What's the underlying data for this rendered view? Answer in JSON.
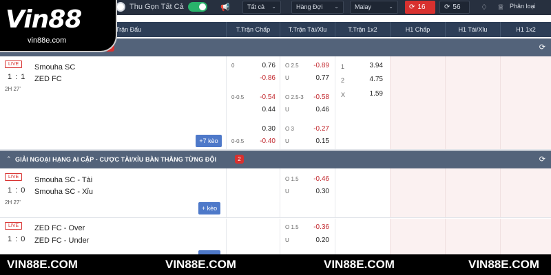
{
  "toolbar": {
    "collapse_all_label": "Thu Gọn Tất Cả",
    "speaker_icon": "speaker-icon",
    "filter_all": "Tất cả",
    "sort_by": "Hàng Đợi",
    "odds_type": "Malay",
    "live_count": "16",
    "upcoming_count": "56",
    "classify_label": "Phân loại"
  },
  "columns": {
    "match": "Trận Đấu",
    "ft_handicap": "T.Trận Chấp",
    "ft_over_under": "T.Trận Tài/Xỉu",
    "ft_1x2": "T.Trận 1x2",
    "h1_handicap": "H1 Chấp",
    "h1_over_under": "H1 Tài/Xỉu",
    "h1_1x2": "H1 1x2"
  },
  "league1": {
    "count": "1"
  },
  "match1": {
    "status": "LIVE",
    "score": "1 : 1",
    "time": "2H 27'",
    "home": "Smouha SC",
    "away": "ZED FC",
    "more": "+7 kèo",
    "rows": [
      {
        "hdp": "0",
        "hdp_home": "0.76",
        "hdp_away": "-0.86",
        "ou_line": "O 2.5",
        "ou_over": "-0.89",
        "ou_u": "U",
        "ou_under": "0.77"
      },
      {
        "hdp": "0-0.5",
        "hdp_home": "-0.54",
        "hdp_away": "0.44",
        "ou_line": "O 2.5-3",
        "ou_over": "-0.58",
        "ou_u": "U",
        "ou_under": "0.46"
      },
      {
        "hdp": "0-0.5",
        "hdp_home": "0.30",
        "hdp_away": "-0.40",
        "ou_line": "O 3",
        "ou_over": "-0.27",
        "ou_u": "U",
        "ou_under": "0.15"
      }
    ],
    "x12": [
      {
        "label": "1",
        "value": "3.94"
      },
      {
        "label": "2",
        "value": "4.75"
      },
      {
        "label": "X",
        "value": "1.59"
      }
    ]
  },
  "league2": {
    "name": "GIẢI NGOẠI HẠNG AI CẬP - CƯỢC TÀI/XỈU BÀN THẮNG TỪNG ĐỘI",
    "count": "2"
  },
  "match2": {
    "status": "LIVE",
    "score": "1 : 0",
    "time": "2H 27'",
    "home": "Smouha SC - Tài",
    "away": "Smouha SC - Xỉu",
    "more": "+ kèo",
    "ou_line": "O 1.5",
    "ou_over": "-0.46",
    "ou_u": "U",
    "ou_under": "0.30"
  },
  "match3": {
    "status": "LIVE",
    "score": "1 : 0",
    "home": "ZED FC - Over",
    "away": "ZED FC - Under",
    "ou_line": "O 1.5",
    "ou_over": "-0.36",
    "ou_u": "U",
    "ou_under": "0.20"
  },
  "logo": {
    "brand": "Vin88",
    "site": "vin88e.com"
  },
  "watermark": [
    "VIN88E.COM",
    "VIN88E.COM",
    "VIN88E.COM",
    "VIN88E.COM"
  ]
}
